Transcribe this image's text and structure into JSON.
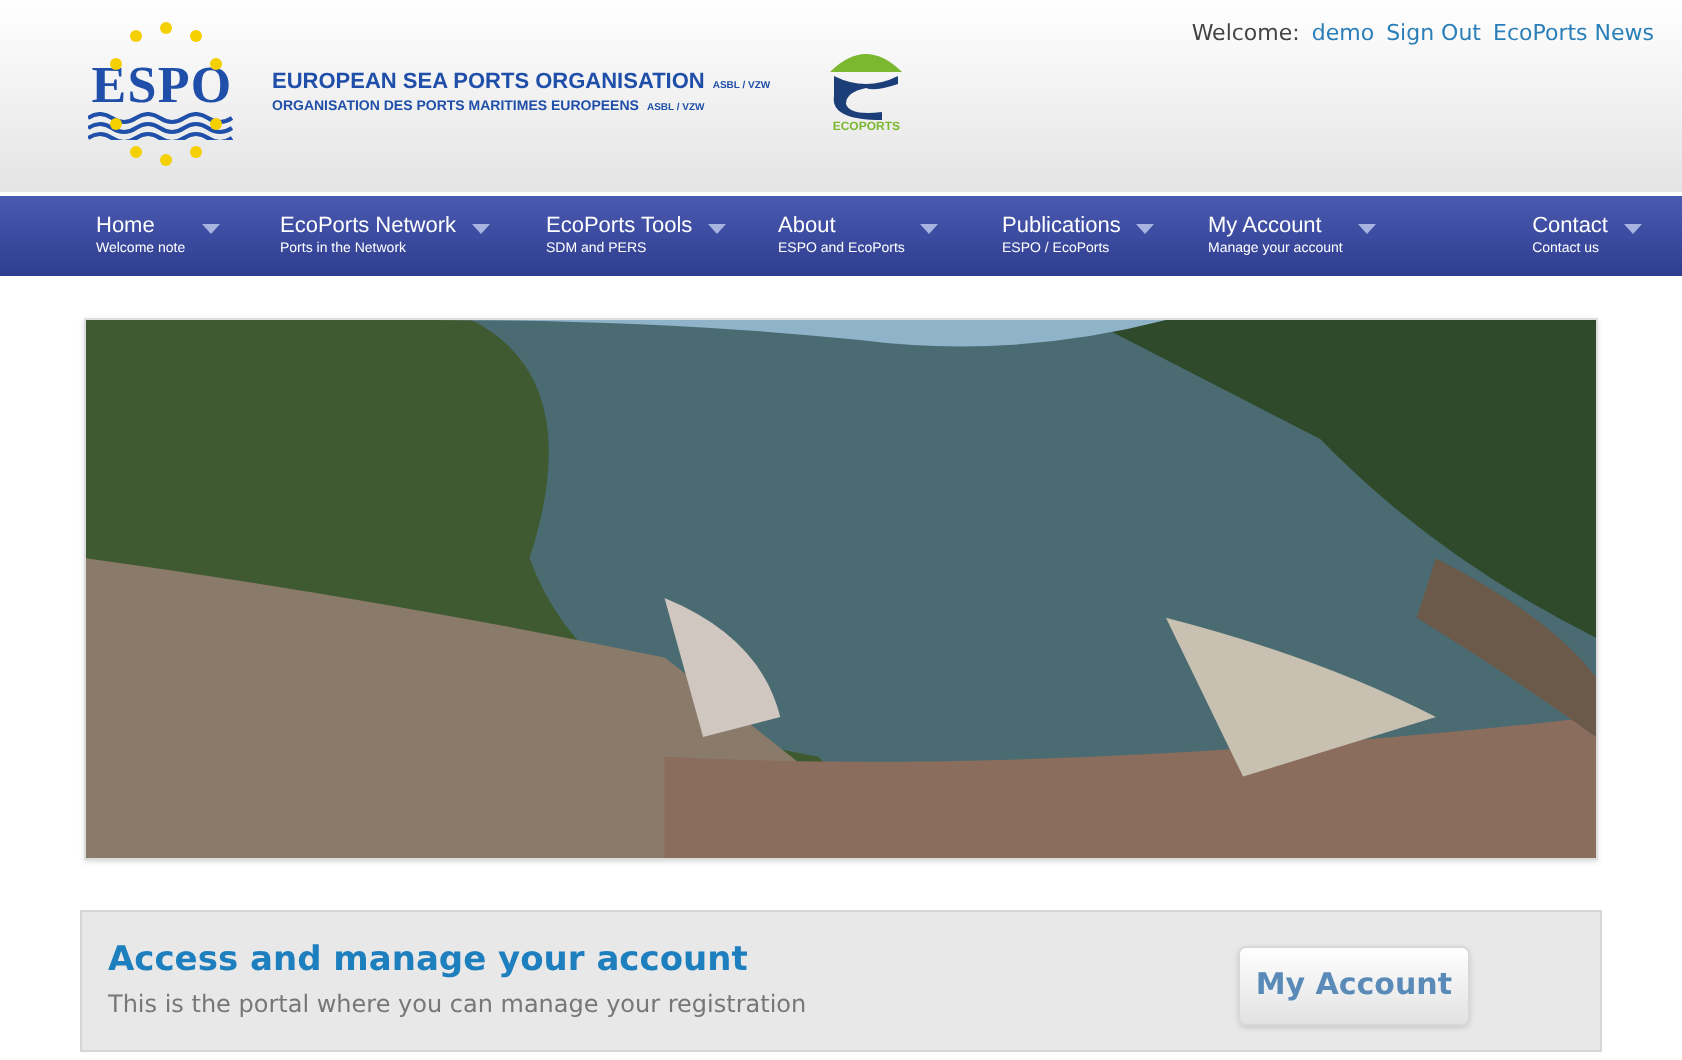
{
  "header": {
    "logo_text": "ESPO",
    "org_name": "EUROPEAN SEA PORTS ORGANISATION",
    "org_name_suffix": "ASBL / VZW",
    "org_name_fr": "ORGANISATION DES PORTS MARITIMES EUROPEENS",
    "org_name_fr_suffix": "ASBL / VZW",
    "partner_logo_text": "ECOPORTS",
    "user_links": [
      {
        "kind": "label",
        "text": "Welcome:"
      },
      {
        "kind": "link",
        "text": "demo"
      },
      {
        "kind": "link",
        "text": "Sign Out"
      },
      {
        "kind": "link",
        "text": "EcoPorts News"
      }
    ]
  },
  "nav": [
    {
      "label": "Home",
      "sublabel": "Welcome note"
    },
    {
      "label": "EcoPorts Network",
      "sublabel": "Ports in the Network"
    },
    {
      "label": "EcoPorts Tools",
      "sublabel": "SDM and PERS"
    },
    {
      "label": "About",
      "sublabel": "ESPO and EcoPorts"
    },
    {
      "label": "Publications",
      "sublabel": "ESPO / EcoPorts"
    },
    {
      "label": "My Account",
      "sublabel": "Manage your account"
    },
    {
      "label": "Contact",
      "sublabel": "Contact us"
    }
  ],
  "account_card": {
    "title": "Access and manage your account",
    "subtitle": "This is the portal where you can manage your registration",
    "button": "My Account"
  }
}
